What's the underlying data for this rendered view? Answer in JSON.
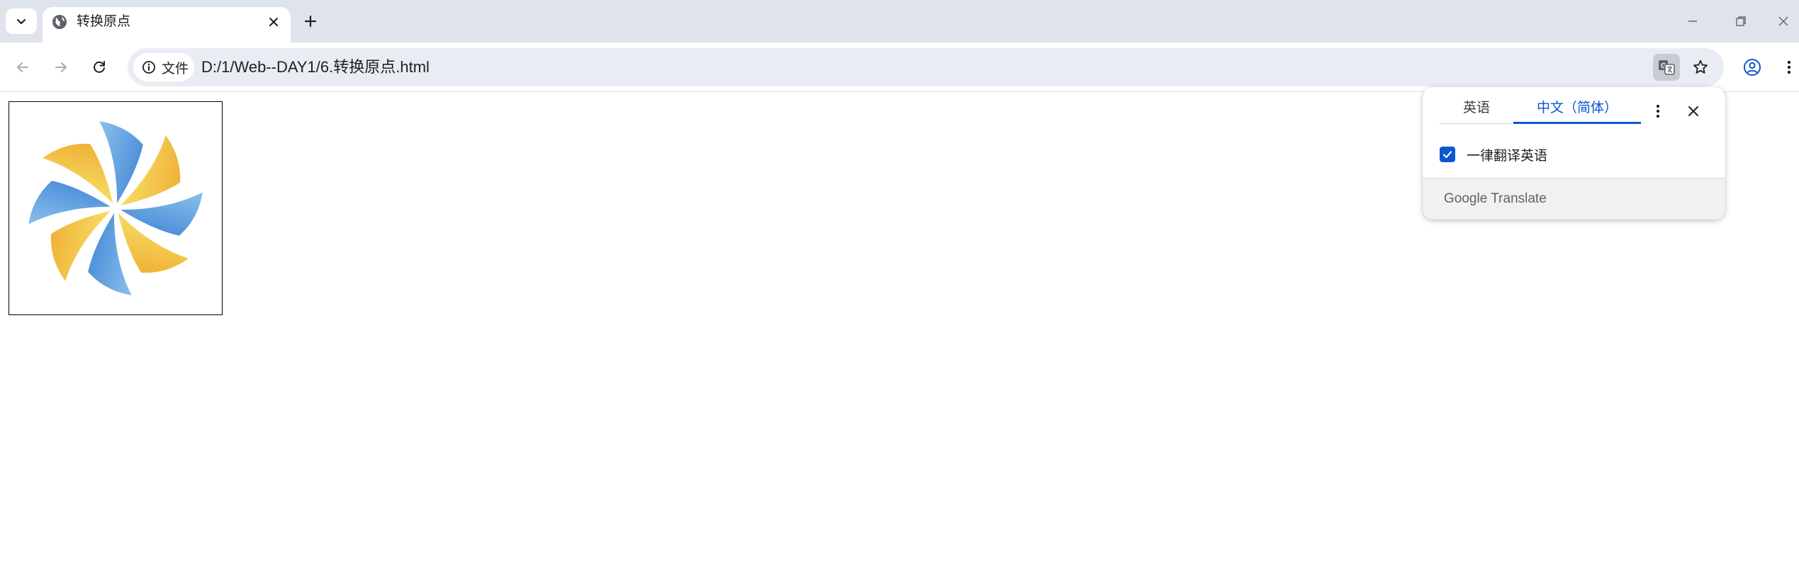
{
  "colors": {
    "tabstrip": "#dfe3eb",
    "omnibox": "#e9edf3",
    "accent_blue": "#0b57d0",
    "petal_blue": "#3f86d8",
    "petal_yellow": "#f2c94c"
  },
  "tab": {
    "title": "转换原点",
    "favicon": "globe-icon"
  },
  "toolbar": {
    "site_chip_label": "文件",
    "url": "D:/1/Web--DAY1/6.转换原点.html"
  },
  "translate_bubble": {
    "source_language": "英语",
    "target_language": "中文（简体）",
    "always_translate_label": "一律翻译英语",
    "always_translate_checked": true,
    "brand_google": "Google",
    "brand_translate": "Translate"
  },
  "page": {
    "image": "pinwheel-image"
  }
}
